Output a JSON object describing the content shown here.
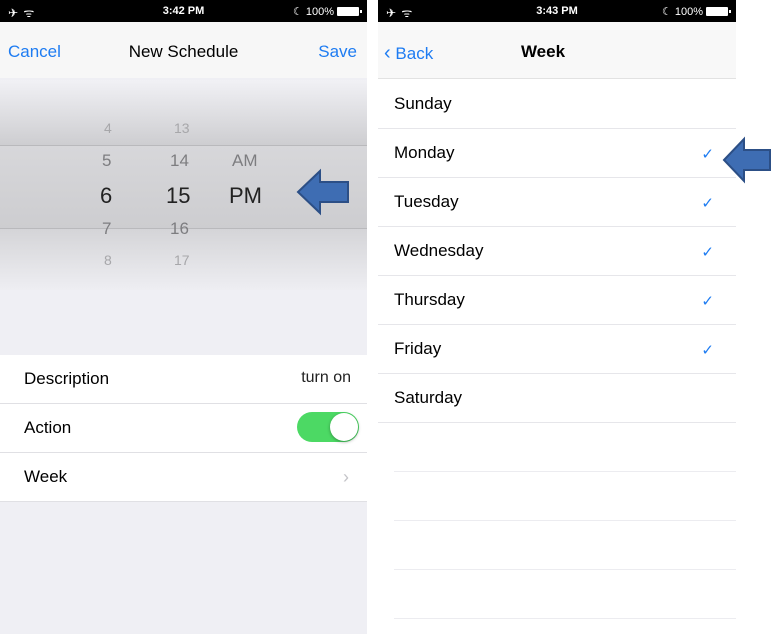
{
  "left_screen": {
    "status_bar": {
      "signal": "✈ ᯤ",
      "time": "3:42 PM",
      "battery": "100%"
    },
    "nav": {
      "cancel_label": "Cancel",
      "title": "New Schedule",
      "save_label": "Save"
    },
    "picker": {
      "hours": [
        "4",
        "5",
        "6",
        "7",
        "8"
      ],
      "minutes": [
        "13",
        "14",
        "15",
        "16",
        "17"
      ],
      "ampm": [
        "AM",
        "PM"
      ],
      "selected": {
        "hour": "6",
        "minute": "15",
        "ampm": "PM"
      }
    },
    "settings": {
      "description": {
        "label": "Description",
        "value": "turn on"
      },
      "action": {
        "label": "Action",
        "enabled": true
      },
      "week": {
        "label": "Week",
        "chevron": "›"
      }
    },
    "accent_color": "#1e7cf2",
    "toggle_color": "#4cd964"
  },
  "right_screen": {
    "status_bar": {
      "signal": "✈ ᯤ",
      "time": "3:43 PM",
      "battery": "100%"
    },
    "nav": {
      "back_label": "Back",
      "title": "Week"
    },
    "days": [
      {
        "label": "Sunday",
        "checked": false
      },
      {
        "label": "Monday",
        "checked": true
      },
      {
        "label": "Tuesday",
        "checked": true
      },
      {
        "label": "Wednesday",
        "checked": true
      },
      {
        "label": "Thursday",
        "checked": true
      },
      {
        "label": "Friday",
        "checked": true
      },
      {
        "label": "Saturday",
        "checked": false
      }
    ],
    "check_glyph": "✓"
  },
  "annotations": {
    "arrow_color": "#3e6db3",
    "arrow_icon": "left-arrow-icon"
  }
}
